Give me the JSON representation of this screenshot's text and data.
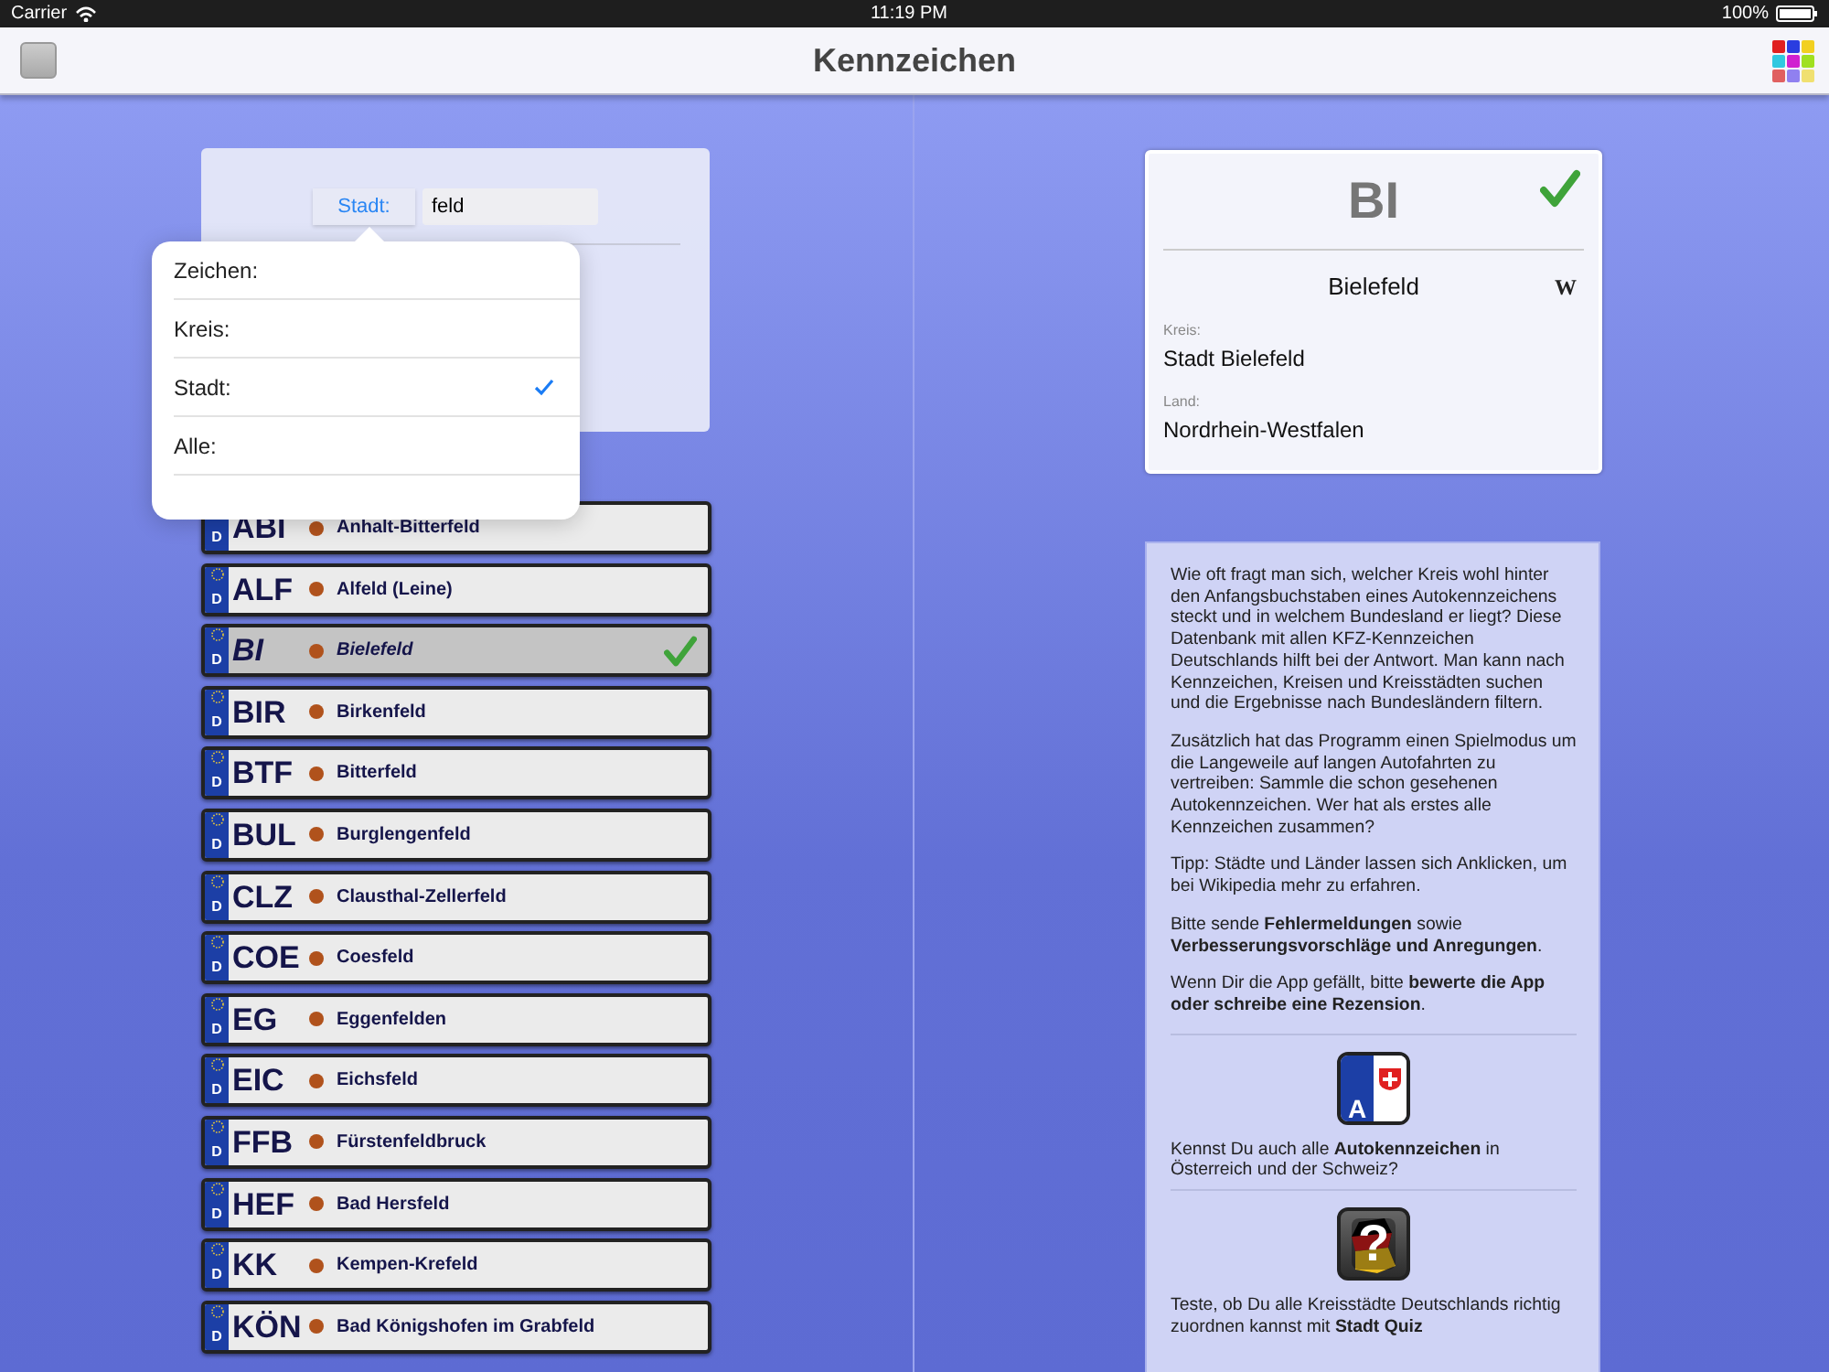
{
  "status_bar": {
    "carrier": "Carrier",
    "time": "11:19 PM",
    "battery": "100%"
  },
  "nav_bar": {
    "title": "Kennzeichen"
  },
  "search": {
    "mode_button": "Stadt:",
    "value": "feld"
  },
  "mode_menu": {
    "items": [
      {
        "label": "Zeichen:",
        "selected": false
      },
      {
        "label": "Kreis:",
        "selected": false
      },
      {
        "label": "Stadt:",
        "selected": true
      },
      {
        "label": "Alle:",
        "selected": false
      }
    ]
  },
  "plates": [
    {
      "country": "D",
      "code": "ABI",
      "name": "Anhalt-Bitterfeld",
      "selected": false,
      "collected": false
    },
    {
      "country": "D",
      "code": "ALF",
      "name": "Alfeld (Leine)",
      "selected": false,
      "collected": false
    },
    {
      "country": "D",
      "code": "BI",
      "name": "Bielefeld",
      "selected": true,
      "collected": true
    },
    {
      "country": "D",
      "code": "BIR",
      "name": "Birkenfeld",
      "selected": false,
      "collected": false
    },
    {
      "country": "D",
      "code": "BTF",
      "name": "Bitterfeld",
      "selected": false,
      "collected": false
    },
    {
      "country": "D",
      "code": "BUL",
      "name": "Burglengenfeld",
      "selected": false,
      "collected": false
    },
    {
      "country": "D",
      "code": "CLZ",
      "name": "Clausthal-Zellerfeld",
      "selected": false,
      "collected": false
    },
    {
      "country": "D",
      "code": "COE",
      "name": "Coesfeld",
      "selected": false,
      "collected": false
    },
    {
      "country": "D",
      "code": "EG",
      "name": "Eggenfelden",
      "selected": false,
      "collected": false
    },
    {
      "country": "D",
      "code": "EIC",
      "name": "Eichsfeld",
      "selected": false,
      "collected": false
    },
    {
      "country": "D",
      "code": "FFB",
      "name": "Fürstenfeldbruck",
      "selected": false,
      "collected": false
    },
    {
      "country": "D",
      "code": "HEF",
      "name": "Bad Hersfeld",
      "selected": false,
      "collected": false
    },
    {
      "country": "D",
      "code": "KK",
      "name": "Kempen-Krefeld",
      "selected": false,
      "collected": false
    },
    {
      "country": "D",
      "code": "KÖN",
      "name": "Bad Königshofen im Grabfeld",
      "selected": false,
      "collected": false
    }
  ],
  "detail": {
    "code": "BI",
    "collected": true,
    "city": "Bielefeld",
    "wiki_link": "W",
    "fields": [
      {
        "label": "Kreis:",
        "value": "Stadt Bielefeld"
      },
      {
        "label": "Land:",
        "value": "Nordrhein-Westfalen"
      }
    ]
  },
  "info": {
    "paragraphs": [
      "Wie oft fragt man sich, welcher Kreis wohl hinter den Anfangsbuchstaben eines Autokennzeichens steckt und in welchem Bundesland er liegt? Diese Datenbank mit allen KFZ-Kennzeichen Deutschlands hilft bei der Antwort. Man kann nach Kennzeichen, Kreisen und Kreisstädten suchen und die Ergebnisse nach Bundesländern filtern.",
      "Zusätzlich hat das Programm einen Spielmodus um die Langeweile auf langen Autofahrten zu vertreiben: Sammle die schon gesehenen Autokennzeichen. Wer hat als erstes alle Kennzeichen zusammen?",
      "Tipp: Städte und Länder lassen sich Anklicken, um bei Wikipedia mehr zu erfahren.",
      "Bitte sende **Fehlermeldungen** sowie **Verbesserungsvorschläge und Anregungen**.",
      "Wenn Dir die App gefällt, bitte **bewerte die App oder schreibe eine Rezension**."
    ],
    "promos": [
      {
        "kind": "plate",
        "icon_glyph": "A",
        "text": "Kennst Du auch alle **Autokennzeichen** in Österreich und der Schweiz?"
      },
      {
        "kind": "quiz",
        "icon_glyph": "?",
        "text": "Teste, ob Du alle Kreisstädte Deutschlands richtig zuordnen kannst mit **Stadt Quiz**"
      }
    ]
  }
}
